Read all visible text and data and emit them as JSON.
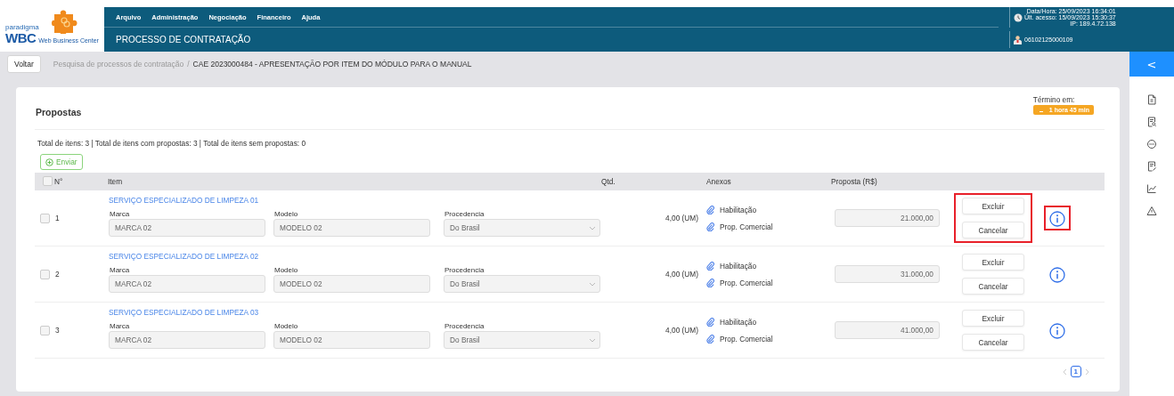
{
  "logo": {
    "brand": "paradigma",
    "name": "WBC",
    "tagline": "Web Business Center"
  },
  "menu": [
    "Arquivo",
    "Administração",
    "Negociação",
    "Financeiro",
    "Ajuda"
  ],
  "page_title": "PROCESSO DE CONTRATAÇÃO",
  "session": {
    "datetime": "Data/Hora: 25/09/2023 16:34:01",
    "last_access": "Últ. acesso: 15/09/2023 15:30:37",
    "ip": "IP: 189.4.72.138",
    "user": "06102125000109"
  },
  "breadcrumb": {
    "back": "Voltar",
    "parent": "Pesquisa de processos de contratação",
    "separator": "/",
    "current": "CAE 2023000484 - APRESENTAÇÃO POR ITEM DO MÓDULO PARA O MANUAL"
  },
  "sidebar_toggle": "<",
  "section_title": "Propostas",
  "deadline": {
    "label": "Término em:",
    "value": "1 hora 45 min"
  },
  "summary": "Total de itens: 3 | Total de itens com propostas: 3 | Total de itens sem propostas: 0",
  "send_button": "Enviar",
  "table": {
    "columns": [
      "N°",
      "Item",
      "Qtd.",
      "Anexos",
      "Proposta (R$)"
    ],
    "all_checked": false,
    "rows": [
      {
        "checked": false,
        "number": "1",
        "item": "SERVIÇO ESPECIALIZADO DE LIMPEZA 01",
        "marca_label": "Marca",
        "marca": "MARCA 02",
        "modelo_label": "Modelo",
        "modelo": "MODELO 02",
        "procedencia_label": "Procedencia",
        "procedencia": "Do Brasil",
        "quantity": "4,00 (UM)",
        "attachments": [
          "Habilitação",
          "Prop. Comercial"
        ],
        "proposal": "21.000,00",
        "delete": "Excluir",
        "cancel": "Cancelar",
        "highlighted": true
      },
      {
        "checked": false,
        "number": "2",
        "item": "SERVIÇO ESPECIALIZADO DE LIMPEZA 02",
        "marca_label": "Marca",
        "marca": "MARCA 02",
        "modelo_label": "Modelo",
        "modelo": "MODELO 02",
        "procedencia_label": "Procedencia",
        "procedencia": "Do Brasil",
        "quantity": "4,00 (UM)",
        "attachments": [
          "Habilitação",
          "Prop. Comercial"
        ],
        "proposal": "31.000,00",
        "delete": "Excluir",
        "cancel": "Cancelar",
        "highlighted": false
      },
      {
        "checked": false,
        "number": "3",
        "item": "SERVIÇO ESPECIALIZADO DE LIMPEZA 03",
        "marca_label": "Marca",
        "marca": "MARCA 02",
        "modelo_label": "Modelo",
        "modelo": "MODELO 02",
        "procedencia_label": "Procedencia",
        "procedencia": "Do Brasil",
        "quantity": "4,00 (UM)",
        "attachments": [
          "Habilitação",
          "Prop. Comercial"
        ],
        "proposal": "41.000,00",
        "delete": "Excluir",
        "cancel": "Cancelar",
        "highlighted": false
      }
    ]
  },
  "pagination": [
    {
      "label": "1",
      "selected": true
    }
  ]
}
